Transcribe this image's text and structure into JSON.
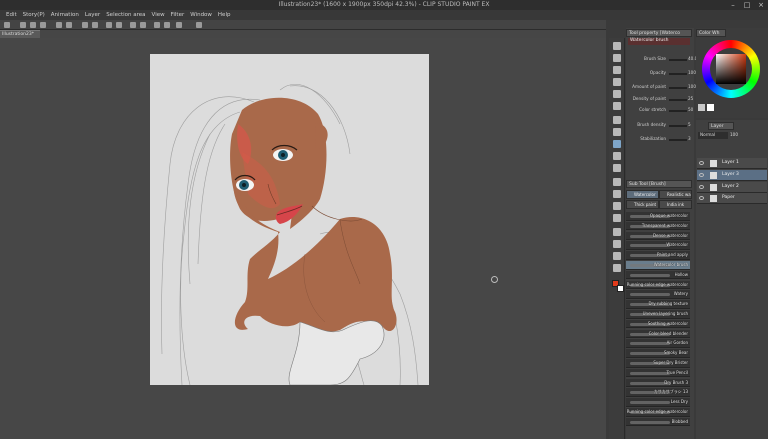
{
  "title": "Illustration23* (1600 x 1900px 350dpi 42.3%)  - CLIP STUDIO PAINT EX",
  "menu": [
    "Edit",
    "Story(P)",
    "Animation",
    "Layer",
    "Selection area",
    "View",
    "Filter",
    "Window",
    "Help"
  ],
  "window_controls": {
    "minimize": "–",
    "maximize": "□",
    "close": "×"
  },
  "document_tab": "Illustration23*",
  "tool_property": {
    "tab": "Tool property [Waterco",
    "header": "Watercolor brush",
    "rows": [
      {
        "label": "Brush Size",
        "value": "40.0"
      },
      {
        "label": "Opacity",
        "value": "100"
      },
      {
        "label": "Amount of paint",
        "value": "100"
      },
      {
        "label": "Density of paint",
        "value": "25"
      },
      {
        "label": "Color stretch",
        "value": "50"
      },
      {
        "label": "Brush density",
        "value": "5"
      },
      {
        "label": "Stabilization",
        "value": "3"
      }
    ]
  },
  "subtool": {
    "tab": "Sub Tool [Brush]",
    "groups": [
      {
        "label": "Watercolor",
        "active": true
      },
      {
        "label": "Realistic wa",
        "active": false
      },
      {
        "label": "Thick paint",
        "active": false
      },
      {
        "label": "India ink",
        "active": false
      }
    ],
    "brushes": [
      "Opaque watercolor",
      "Transparent watercolor",
      "Dense watercolor",
      "Watercolor",
      "Paint and apply",
      "Watercolor brush",
      "Hollow",
      "Running color edge watercolor",
      "Watery",
      "Dry rubbing texture",
      "Uneven layering brush",
      "Soothing watercolor",
      "Color bleed blender",
      "Air Gordon",
      "Smoky Bear",
      "Super Dry Brister",
      "True Pencil",
      "Dry Brush 3",
      "カサカサブラシ 13",
      "Less Dry",
      "Running color edge watercolor",
      "Blobbed"
    ],
    "selected_brush": "Watercolor brush"
  },
  "color": {
    "tab": "Color Wh",
    "main": "#e03a1a",
    "sub": "#ffffff",
    "hue": "#d03a10"
  },
  "layer_panel": {
    "tab": "Layer",
    "blend_mode": "Normal",
    "opacity": "100",
    "layers": [
      {
        "name": "Layer 1",
        "selected": false
      },
      {
        "name": "Layer 3",
        "selected": true
      },
      {
        "name": "Layer 2",
        "selected": false
      },
      {
        "name": "Paper",
        "selected": false
      }
    ]
  }
}
